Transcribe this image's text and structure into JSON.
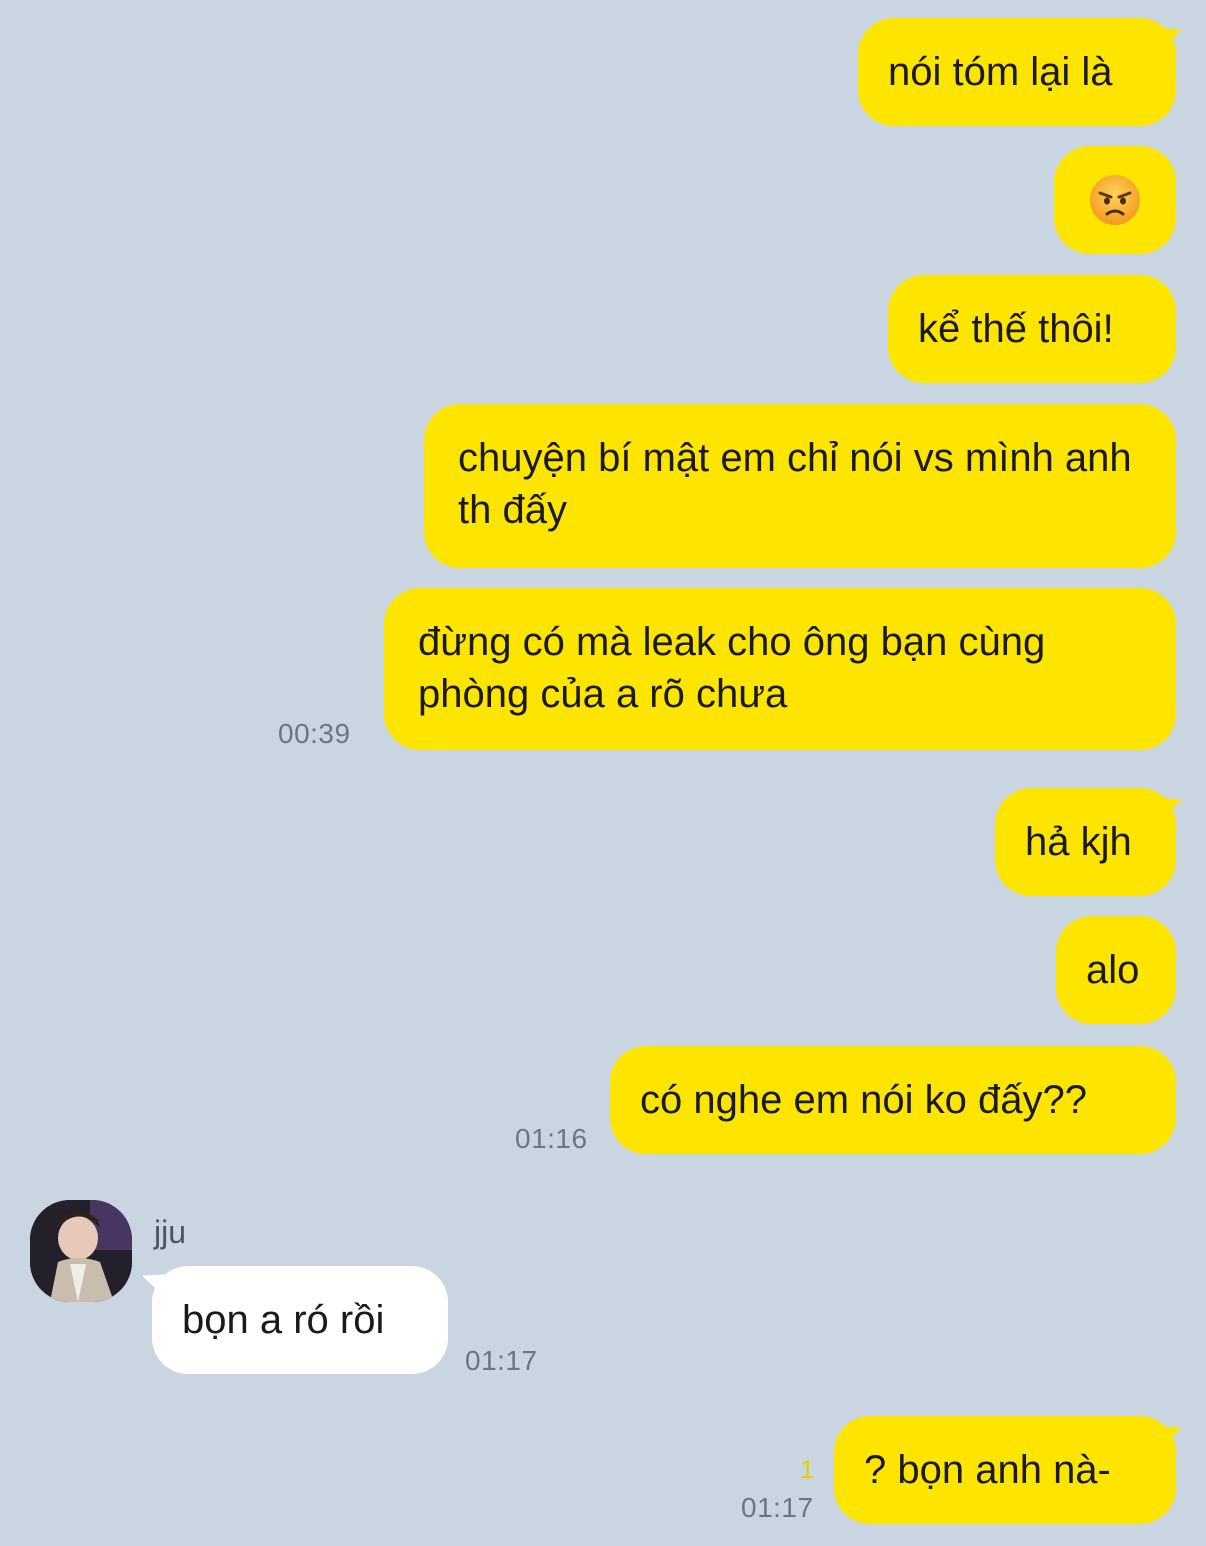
{
  "messages": {
    "m1": "nói tóm lại là",
    "m2_emoji": "angry-face",
    "m3": "kể thế thôi!",
    "m4": "chuyện bí mật em chỉ nói vs mình anh th đấy",
    "m5": "đừng có mà leak cho ông bạn cùng phòng của a rõ chưa",
    "m5_time": "00:39",
    "m6": "hả kjh",
    "m7": "alo",
    "m8": "có nghe em nói ko đấy??",
    "m8_time": "01:16",
    "m9_sender": "jju",
    "m9": "bọn a ró rồi",
    "m9_time": "01:17",
    "m10": "? bọn anh nà-",
    "m10_unread": "1",
    "m10_time": "01:17"
  },
  "colors": {
    "background": "#c9d5e1",
    "outgoing_bubble": "#fee500",
    "incoming_bubble": "#ffffff"
  }
}
